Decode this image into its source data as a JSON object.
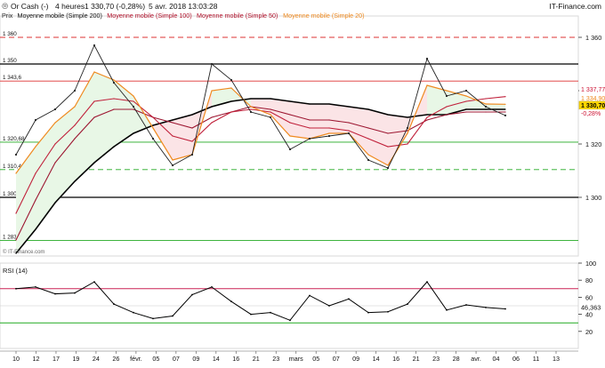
{
  "header": {
    "instrument": "Or Cash (-)",
    "interval": "4 heures",
    "last_change": "1 330,70 (-0,28%)",
    "datetime": "5 avr. 2018 13:03:28",
    "brand": "IT-Finance.com"
  },
  "legend": [
    {
      "label": "Prix",
      "color": "#222222"
    },
    {
      "label": "Moyenne mobile (Simple 200)",
      "color": "#000000"
    },
    {
      "label": "Moyenne mobile (Simple 100)",
      "color": "#b0102a"
    },
    {
      "label": "Moyenne mobile (Simple 50)",
      "color": "#b0102a"
    },
    {
      "label": "Moyenne mobile (Simple 20)",
      "color": "#ef8a20"
    }
  ],
  "colors": {
    "price": "#222222",
    "sma200": "#000000",
    "sma100": "#9c1530",
    "sma50": "#c0203a",
    "sma20": "#ef8a20",
    "resistance": "#dd3333",
    "support": "#22aa22",
    "neutral": "#000000",
    "rsi_line": "#000000",
    "rsi_over": "#cc2255",
    "rsi_under": "#22aa22",
    "fill_bull": "#e8f7e6",
    "fill_bear": "#fbe4e6"
  },
  "price_axis": {
    "ticks": [
      "1 360",
      "1 340",
      "1 320",
      "1 300"
    ]
  },
  "levels": [
    {
      "label": "1 360",
      "value": 1360,
      "style": "dashed",
      "color": "#dd3333"
    },
    {
      "label": "1 350",
      "value": 1350,
      "style": "solid",
      "color": "#000000"
    },
    {
      "label": "1 343,6",
      "value": 1343.6,
      "style": "thin",
      "color": "#dd3333"
    },
    {
      "label": "1 320,68",
      "value": 1320.68,
      "style": "thin",
      "color": "#22aa22"
    },
    {
      "label": "1 310,4",
      "value": 1310.4,
      "style": "dashed",
      "color": "#22aa22"
    },
    {
      "label": "1 300",
      "value": 1300,
      "style": "solid",
      "color": "#000000"
    },
    {
      "label": "1 283,8",
      "value": 1283.8,
      "style": "thin",
      "color": "#22aa22"
    }
  ],
  "price_tags": [
    {
      "label": "1 337,77",
      "bg": "#ffffff",
      "fg": "#cc1133"
    },
    {
      "label": "1 334,90",
      "bg": "#ffffff",
      "fg": "#ef8a20"
    },
    {
      "label": "1 330,70",
      "bg": "#ffd800",
      "fg": "#000000"
    },
    {
      "label": "-0,28%",
      "bg": "#ffffff",
      "fg": "#cc1133"
    }
  ],
  "copyright": "© IT-Finance.com",
  "rsi": {
    "title": "RSI (14)",
    "ticks": [
      "100",
      "80",
      "60",
      "40",
      "20"
    ],
    "value_label": "46,363",
    "overbought": 70,
    "oversold": 30
  },
  "x_axis": {
    "labels": [
      "10",
      "12",
      "17",
      "19",
      "24",
      "26",
      "févr.",
      "05",
      "07",
      "09",
      "14",
      "16",
      "21",
      "23",
      "mars",
      "05",
      "07",
      "09",
      "14",
      "16",
      "21",
      "23",
      "28",
      "avr.",
      "04",
      "06",
      "11",
      "13"
    ]
  },
  "chart_data": {
    "type": "line",
    "title": "Or Cash (-) 4 heures",
    "x": [
      "10",
      "12",
      "17",
      "19",
      "24",
      "26",
      "févr.",
      "05",
      "07",
      "09",
      "14",
      "16",
      "21",
      "23",
      "mars",
      "05",
      "07",
      "09",
      "14",
      "16",
      "21",
      "23",
      "28",
      "avr.",
      "04",
      "06"
    ],
    "ylim": [
      1278,
      1368
    ],
    "series": [
      {
        "name": "Prix",
        "values": [
          1316,
          1329,
          1333,
          1340,
          1357,
          1343,
          1334,
          1322,
          1312,
          1316,
          1350,
          1344,
          1332,
          1330,
          1318,
          1322,
          1323,
          1324,
          1314,
          1311,
          1326,
          1352,
          1338,
          1340,
          1334,
          1330.7
        ]
      },
      {
        "name": "Moyenne mobile (Simple 20)",
        "values": [
          1309,
          1319,
          1328,
          1334,
          1347,
          1344,
          1338,
          1326,
          1314,
          1316,
          1340,
          1341,
          1334,
          1331,
          1323,
          1322,
          1324,
          1324,
          1316,
          1312,
          1324,
          1342,
          1340,
          1338,
          1335,
          1334.9
        ]
      },
      {
        "name": "Moyenne mobile (Simple 50)",
        "values": [
          1294,
          1309,
          1320,
          1327,
          1336,
          1337,
          1336,
          1330,
          1323,
          1321,
          1328,
          1332,
          1333,
          1332,
          1328,
          1326,
          1326,
          1325,
          1322,
          1319,
          1320,
          1330,
          1334,
          1336,
          1337,
          1337.77
        ]
      },
      {
        "name": "Moyenne mobile (Simple 100)",
        "values": [
          1284,
          1299,
          1313,
          1322,
          1330,
          1333,
          1333,
          1330,
          1328,
          1326,
          1330,
          1332,
          1334,
          1333,
          1331,
          1329,
          1329,
          1328,
          1326,
          1324,
          1325,
          1329,
          1331,
          1332,
          1332,
          1332
        ]
      },
      {
        "name": "Moyenne mobile (Simple 200)",
        "values": [
          1279,
          1288,
          1298,
          1306,
          1313,
          1319,
          1324,
          1327,
          1329,
          1331,
          1334,
          1336,
          1337,
          1337,
          1336,
          1335,
          1335,
          1334,
          1333,
          1331,
          1330,
          1331,
          1331,
          1333,
          1333,
          1333
        ]
      }
    ],
    "rsi": {
      "name": "RSI (14)",
      "values": [
        70,
        72,
        64,
        65,
        78,
        52,
        42,
        35,
        38,
        63,
        72,
        55,
        40,
        42,
        33,
        62,
        50,
        58,
        42,
        43,
        52,
        78,
        45,
        51,
        48,
        46.363
      ],
      "ylim": [
        0,
        100
      ]
    }
  }
}
